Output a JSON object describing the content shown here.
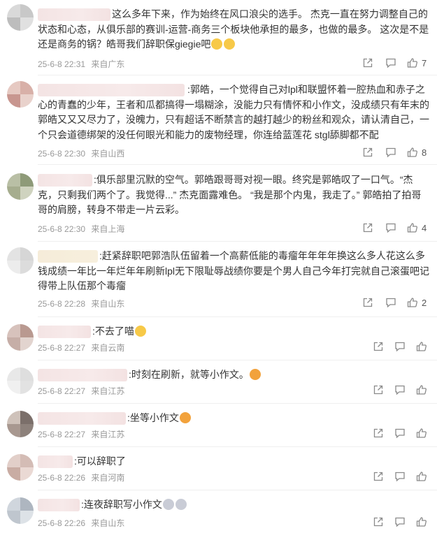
{
  "comments": [
    {
      "text": "这么多年下来，作为始终在风口浪尖的选手。 杰克一直在努力调整自己的状态和心态，从俱乐部的赛训-运营-商务三个板块他承担的最多，也做的最多。 这次是不是还是商务的锅？皓哥我们辞职保giegie吧",
      "date": "25-6-8 22:31",
      "location": "来自广东",
      "likes": "7",
      "emojis": [
        "cat-face-icon",
        "cat-face-icon"
      ]
    },
    {
      "text": ":郭皓，一个觉得自己对lpl和联盟怀着一腔热血和赤子之心的青蠢的少年，王者和瓜都搞得一塌糊涂，没能力只有情怀和小作文，没成绩只有年末的郭皓又又又尽力了，没魄力，只有超话不断禁言的越打越少的粉丝和观众，请认清自己，一个只会道德绑架的没任何眼光和能力的废物经理，你连给蓝莲花 stgl舔脚都不配",
      "date": "25-6-8 22:30",
      "location": "来自山西",
      "likes": "8",
      "emojis": []
    },
    {
      "text": ":俱乐部里沉默的空气。郭皓跟哥哥对视一眼。终究是郭皓叹了一口气。“杰克，只剩我们两个了。我觉得...” 杰克面露难色。 “我是那个内鬼，我走了。” 郭皓拍了拍哥哥的肩膀，转身不带走一片云彩。",
      "date": "25-6-8 22:30",
      "location": "来自上海",
      "likes": "4",
      "emojis": []
    },
    {
      "text": ":赶紧辞职吧郭浩队伍留着一个高薪低能的毒瘤年年年年换这么多人花这么多钱成绩一年比一年烂年年刷新lpl无下限耻辱战绩你要是个男人自己今年打完就自己滚蛋吧记得带上队伍那个毒瘤",
      "date": "25-6-8 22:28",
      "location": "来自山东",
      "likes": "2",
      "emojis": []
    },
    {
      "text": ":不去了喵",
      "date": "25-6-8 22:27",
      "location": "来自云南",
      "likes": "",
      "emojis": [
        "cat-face-icon"
      ]
    },
    {
      "text": ":时刻在刷新，就等小作文。",
      "date": "25-6-8 22:27",
      "location": "来自江苏",
      "likes": "",
      "emojis": [
        "screaming-face-icon"
      ]
    },
    {
      "text": ":坐等小作文",
      "date": "25-6-8 22:27",
      "location": "来自江苏",
      "likes": "",
      "emojis": [
        "screaming-face-icon"
      ]
    },
    {
      "text": ":可以辞职了",
      "date": "25-6-8 22:26",
      "location": "来自河南",
      "likes": "",
      "emojis": []
    },
    {
      "text": ":连夜辞职写小作文",
      "date": "25-6-8 22:26",
      "location": "来自山东",
      "likes": "",
      "emojis": [
        "crying-face-icon",
        "crying-face-icon"
      ]
    }
  ],
  "colors": {
    "text": "#333333",
    "meta": "#999999",
    "icon": "#8a8a8a",
    "divider": "#efefef",
    "username_blur": "#f4e4e4"
  }
}
